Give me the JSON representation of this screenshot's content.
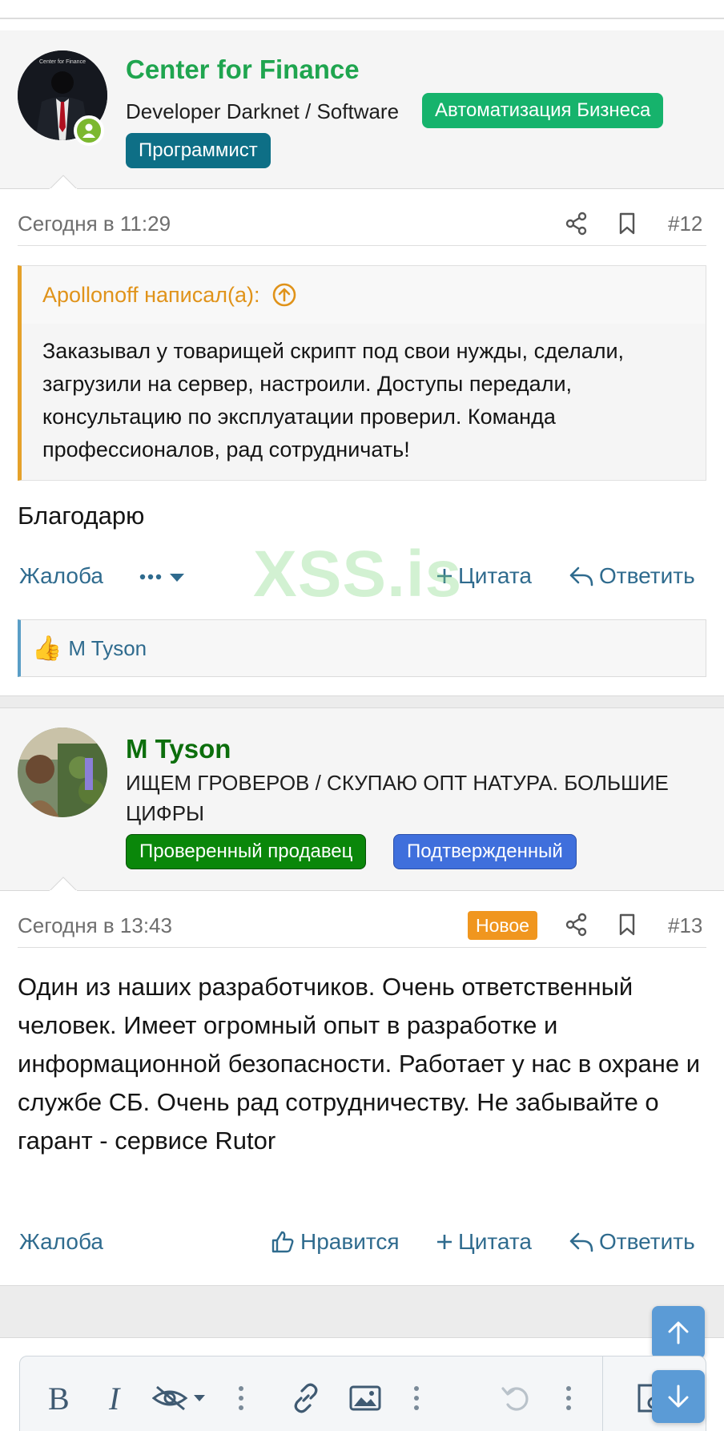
{
  "post12": {
    "author": "Center for Finance",
    "title": "Developer Darknet / Software",
    "badges": [
      "Автоматизация Бизнеса",
      "Программист"
    ],
    "time": "Сегодня в 11:29",
    "number": "#12",
    "quote": {
      "header": "Apollonoff написал(а):",
      "text": "Заказывал у товарищей скрипт под свои нужды, сделали, загрузили на сервер, настроили. Доступы передали, консультацию по эксплуатации проверил. Команда профессионалов, рад сотрудничать!"
    },
    "text": "Благодарю",
    "actions": {
      "report": "Жалоба",
      "quote": "Цитата",
      "reply": "Ответить"
    },
    "reaction_user": "M Tyson"
  },
  "post13": {
    "author": "M Tyson",
    "title": "ИЩЕМ ГРОВЕРОВ / СКУПАЮ ОПТ НАТУРА. БОЛЬШИЕ ЦИФРЫ",
    "badges": [
      "Проверенный продавец",
      "Подтвержденный"
    ],
    "time": "Сегодня в 13:43",
    "new_label": "Новое",
    "number": "#13",
    "text": "Один из наших разработчиков. Очень ответственный человек. Имеет огромный опыт в разработке и информационной безопасности. Работает у нас в охране и службе СБ. Очень рад сотрудничеству. Не забывайте о гарант - сервисе Rutor",
    "actions": {
      "report": "Жалоба",
      "like": "Нравится",
      "quote": "Цитата",
      "reply": "Ответить"
    }
  },
  "watermark": "XSS.is",
  "avatar_text": "Center for Finance",
  "editor": {
    "bold": "B",
    "italic": "I"
  },
  "colors": {
    "author_green": "#1fa54f",
    "author_dark_green": "#0c6e0c",
    "badge_automation": "#16b36c",
    "badge_programmer": "#0e6f86",
    "badge_verified_seller": "#0a870a",
    "badge_confirmed": "#3f6fdc",
    "new_badge": "#f0961f",
    "link_blue": "#2f6b8e",
    "quote_accent": "#e5a12a"
  }
}
